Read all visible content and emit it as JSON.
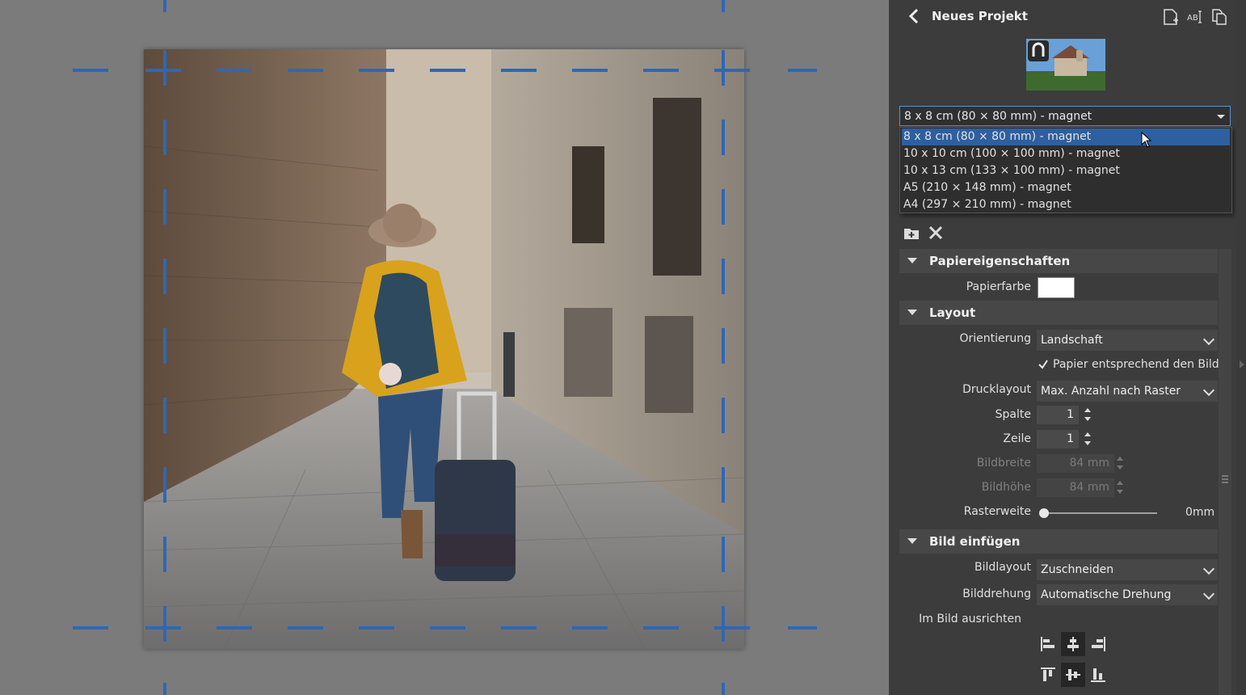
{
  "header": {
    "title": "Neues Projekt"
  },
  "format": {
    "selected": "8 x 8 cm (80 × 80 mm) - magnet",
    "options": [
      "8 x 8 cm (80 × 80 mm) - magnet",
      "10 x 10 cm (100 × 100 mm) - magnet",
      "10 x 13 cm (133 × 100 mm) - magnet",
      "A5 (210 × 148 mm) - magnet",
      "A4 (297 × 210 mm) - magnet"
    ]
  },
  "paper": {
    "section": "Papiereigenschaften",
    "color_label": "Papierfarbe",
    "color": "#ffffff"
  },
  "layout": {
    "section": "Layout",
    "orientation_label": "Orientierung",
    "orientation": "Landschaft",
    "match_label": "Papier entsprechend den Bild...",
    "print_layout_label": "Drucklayout",
    "print_layout": "Max. Anzahl nach Raster",
    "column_label": "Spalte",
    "column": "1",
    "row_label": "Zeile",
    "row": "1",
    "width_label": "Bildbreite",
    "width": "84 mm",
    "height_label": "Bildhöhe",
    "height": "84 mm",
    "spacing_label": "Rasterweite",
    "spacing": "0mm"
  },
  "insert": {
    "section": "Bild einfügen",
    "image_layout_label": "Bildlayout",
    "image_layout": "Zuschneiden",
    "rotation_label": "Bilddrehung",
    "rotation": "Automatische Drehung",
    "align_label": "Im Bild ausrichten"
  },
  "colors": {
    "accent": "#2e5f9f",
    "cut_marks": "#2f67b5",
    "panel": "#3c3c3c",
    "canvas": "#7b7b7b"
  }
}
